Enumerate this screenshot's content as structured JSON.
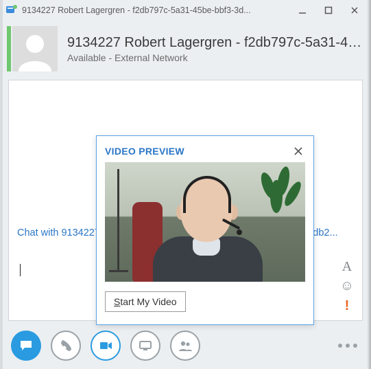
{
  "window": {
    "title": "9134227 Robert Lagergren - f2db797c-5a31-45be-bbf3-3d..."
  },
  "contact": {
    "name": "9134227 Robert Lagergren - f2db797c-5a31-45be-b...",
    "status": "Available - External Network",
    "presence_color": "#6fc76f"
  },
  "conversation": {
    "notice": "Chat with 9134227 Robert Lagergren - f2db797c-5a31-45be-bbf3-3db2..."
  },
  "format_bar": {
    "font_letter": "A",
    "emoji": "☺",
    "priority": "!"
  },
  "popup": {
    "title": "VIDEO PREVIEW",
    "button_prefix": "S",
    "button_rest": "tart My Video"
  },
  "colors": {
    "accent": "#2a9be0",
    "link": "#2a76c6",
    "danger": "#e86a28"
  }
}
